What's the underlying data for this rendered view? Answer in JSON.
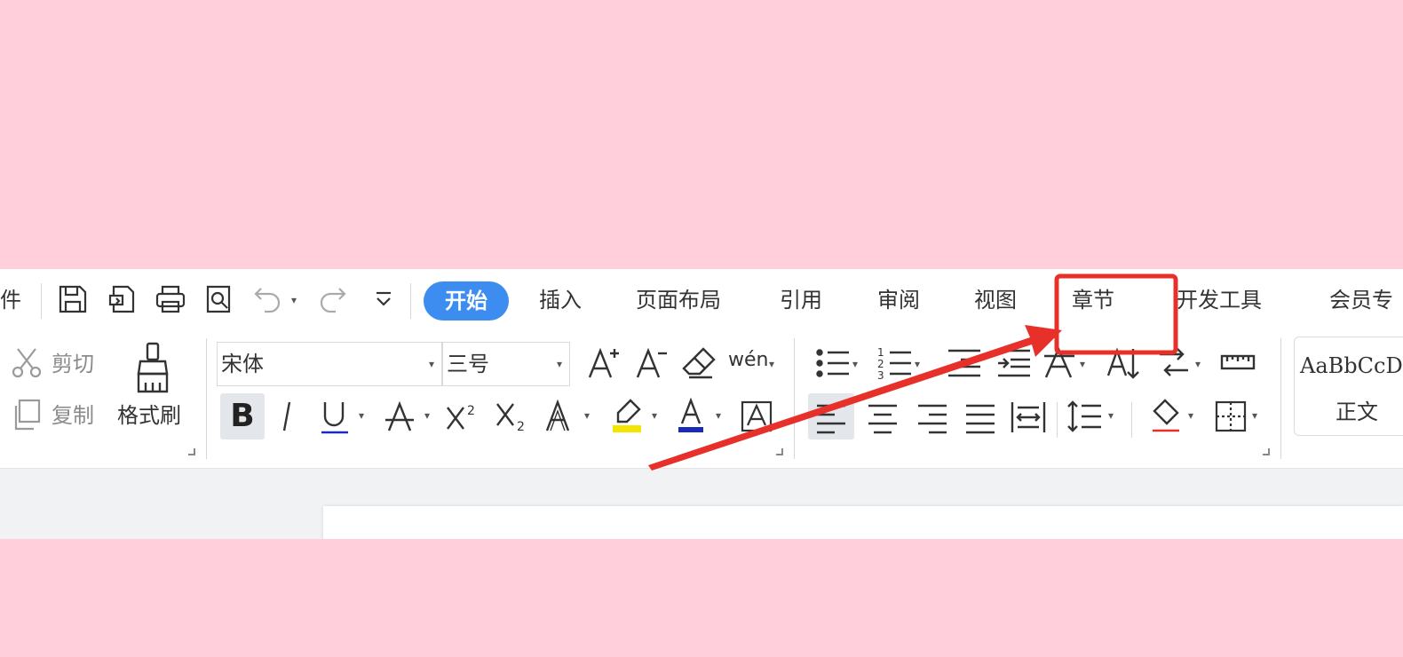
{
  "menu": {
    "file_fragment": "件",
    "tabs": [
      {
        "label": "开始",
        "active": true
      },
      {
        "label": "插入"
      },
      {
        "label": "页面布局"
      },
      {
        "label": "引用"
      },
      {
        "label": "审阅"
      },
      {
        "label": "视图"
      },
      {
        "label": "章节",
        "highlighted": true
      },
      {
        "label": "开发工具"
      },
      {
        "label": "会员专"
      }
    ],
    "quick_access_icons": [
      "save-icon",
      "export-pdf-icon",
      "print-icon",
      "print-preview-icon",
      "undo-icon",
      "redo-icon",
      "customize-toolbar-icon"
    ]
  },
  "clipboard": {
    "cut_label": "剪切",
    "copy_label": "复制",
    "format_painter_label": "格式刷"
  },
  "font": {
    "family": "宋体",
    "size": "三号",
    "buttons": [
      "grow-font-icon",
      "shrink-font-icon",
      "clear-format-icon",
      "pinyin-guide-icon",
      "bold-icon",
      "italic-icon",
      "underline-icon",
      "strikethrough-icon",
      "superscript-icon",
      "subscript-icon",
      "text-effect-icon",
      "highlight-icon",
      "font-color-icon",
      "char-border-icon"
    ],
    "pinyin_glyph": "wén"
  },
  "paragraph": {
    "buttons": [
      "bullets-icon",
      "numbering-icon",
      "decrease-indent-icon",
      "increase-indent-icon",
      "chinese-layout-icon",
      "sort-icon",
      "show-marks-icon",
      "ruler-icon",
      "align-left-icon",
      "align-center-icon",
      "align-right-icon",
      "justify-icon",
      "distributed-icon",
      "line-spacing-icon",
      "shading-icon",
      "borders-icon"
    ]
  },
  "styles": {
    "sample": "AaBbCcDd",
    "name": "正文"
  },
  "colors": {
    "accent": "#3d8cf0",
    "background": "#ffd0dc",
    "annotation": "#e8302a",
    "highlight_yellow": "#f4e400",
    "font_color_blue": "#1a2bb8"
  }
}
